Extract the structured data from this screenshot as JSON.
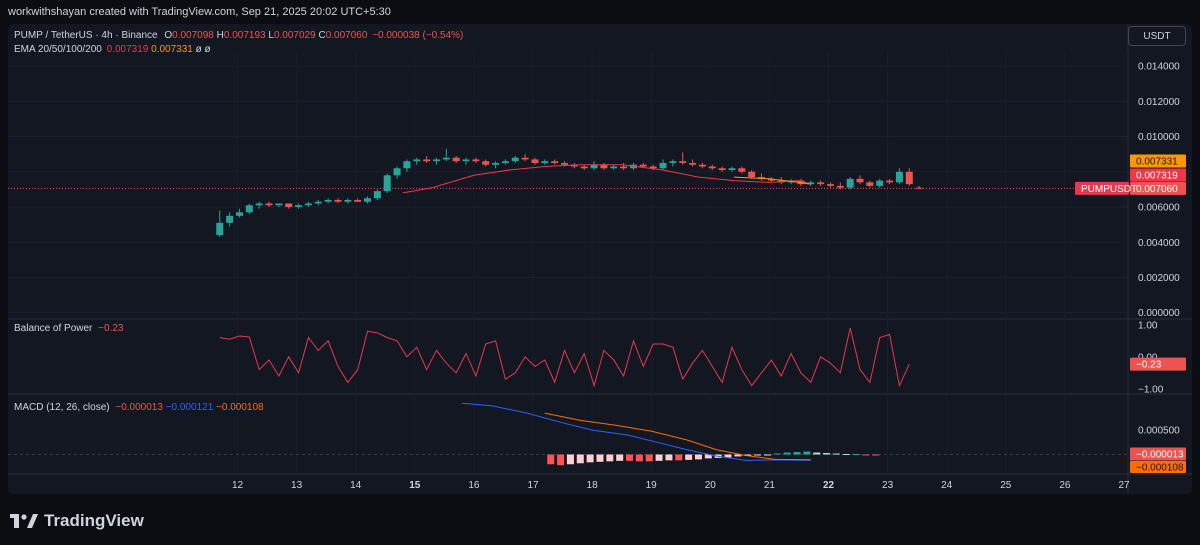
{
  "header": {
    "created_by": "workwithshayan created with TradingView.com, Sep 21, 2025 20:02 UTC+5:30"
  },
  "symbol_legend": {
    "name": "PUMP / TetherUS · 4h · Binance",
    "o_label": "O",
    "o": "0.007098",
    "h_label": "H",
    "h": "0.007193",
    "l_label": "L",
    "l": "0.007029",
    "c_label": "C",
    "c": "0.007060",
    "change": "−0.000038 (−0.54%)"
  },
  "ema_legend": {
    "name": "EMA 20/50/100/200",
    "v20": "0.007319",
    "v50": "0.007331",
    "v100": "ø",
    "v200": "ø"
  },
  "currency_button": "USDT",
  "price_badges": {
    "ema50": "0.007331",
    "ema20": "0.007319",
    "symbol": "PUMPUSDT",
    "last": "0.007060"
  },
  "bop_legend": {
    "name": "Balance of Power",
    "value": "−0.23"
  },
  "macd_legend": {
    "name": "MACD (12, 26, close)",
    "hist": "−0.000013",
    "macd": "−0.000121",
    "signal": "−0.000108"
  },
  "macd_badges": {
    "hist": "−0.000013",
    "signal": "−0.000108"
  },
  "brand": "TradingView",
  "colors": {
    "up": "#26a69a",
    "down": "#ef5350",
    "ema20": "#f23645",
    "ema50": "#ff9800",
    "bop": "#e53950",
    "macd": "#2962ff",
    "signal": "#ff6d00",
    "bg": "#131722",
    "text": "#d1d4dc"
  },
  "chart_data": [
    {
      "type": "candlestick",
      "title": "PUMP / TetherUS · 4h · Binance",
      "x_ticks": [
        "12",
        "13",
        "14",
        "15",
        "16",
        "17",
        "18",
        "19",
        "20",
        "21",
        "22",
        "23",
        "24",
        "25",
        "26",
        "27"
      ],
      "y_ticks": [
        "0.014000",
        "0.012000",
        "0.010000",
        "0.008000",
        "0.006000",
        "0.004000",
        "0.002000",
        "0.000000"
      ],
      "ylim": [
        -0.0003,
        0.0148
      ],
      "x_start_day": 11.7,
      "bars_per_day": 6,
      "candles": [
        {
          "o": 0.0044,
          "h": 0.0058,
          "l": 0.0043,
          "c": 0.0051
        },
        {
          "o": 0.0051,
          "h": 0.0057,
          "l": 0.0049,
          "c": 0.0055
        },
        {
          "o": 0.0055,
          "h": 0.0059,
          "l": 0.0054,
          "c": 0.0057
        },
        {
          "o": 0.0057,
          "h": 0.0062,
          "l": 0.0056,
          "c": 0.0061
        },
        {
          "o": 0.0061,
          "h": 0.0063,
          "l": 0.0059,
          "c": 0.0062
        },
        {
          "o": 0.0062,
          "h": 0.0063,
          "l": 0.006,
          "c": 0.0061
        },
        {
          "o": 0.0061,
          "h": 0.0062,
          "l": 0.006,
          "c": 0.0062
        },
        {
          "o": 0.0062,
          "h": 0.0062,
          "l": 0.0059,
          "c": 0.006
        },
        {
          "o": 0.006,
          "h": 0.0062,
          "l": 0.0059,
          "c": 0.0061
        },
        {
          "o": 0.0061,
          "h": 0.0063,
          "l": 0.006,
          "c": 0.0062
        },
        {
          "o": 0.0062,
          "h": 0.0064,
          "l": 0.0061,
          "c": 0.0063
        },
        {
          "o": 0.0063,
          "h": 0.0065,
          "l": 0.0062,
          "c": 0.0064
        },
        {
          "o": 0.0064,
          "h": 0.0065,
          "l": 0.0062,
          "c": 0.0063
        },
        {
          "o": 0.0063,
          "h": 0.0065,
          "l": 0.0062,
          "c": 0.0064
        },
        {
          "o": 0.0064,
          "h": 0.0065,
          "l": 0.0063,
          "c": 0.0063
        },
        {
          "o": 0.0063,
          "h": 0.0066,
          "l": 0.0062,
          "c": 0.0065
        },
        {
          "o": 0.0065,
          "h": 0.007,
          "l": 0.0064,
          "c": 0.0069
        },
        {
          "o": 0.0069,
          "h": 0.0079,
          "l": 0.0068,
          "c": 0.0078
        },
        {
          "o": 0.0078,
          "h": 0.0083,
          "l": 0.0076,
          "c": 0.0082
        },
        {
          "o": 0.0082,
          "h": 0.0087,
          "l": 0.008,
          "c": 0.0086
        },
        {
          "o": 0.0086,
          "h": 0.0088,
          "l": 0.0084,
          "c": 0.0087
        },
        {
          "o": 0.0087,
          "h": 0.0089,
          "l": 0.0085,
          "c": 0.0086
        },
        {
          "o": 0.0086,
          "h": 0.0088,
          "l": 0.0084,
          "c": 0.0087
        },
        {
          "o": 0.0087,
          "h": 0.0093,
          "l": 0.0086,
          "c": 0.0088
        },
        {
          "o": 0.0088,
          "h": 0.0089,
          "l": 0.0085,
          "c": 0.0086
        },
        {
          "o": 0.0086,
          "h": 0.0088,
          "l": 0.0084,
          "c": 0.0087
        },
        {
          "o": 0.0087,
          "h": 0.0088,
          "l": 0.0085,
          "c": 0.0086
        },
        {
          "o": 0.0086,
          "h": 0.0087,
          "l": 0.0083,
          "c": 0.0084
        },
        {
          "o": 0.0084,
          "h": 0.0086,
          "l": 0.0082,
          "c": 0.0085
        },
        {
          "o": 0.0085,
          "h": 0.0087,
          "l": 0.0084,
          "c": 0.0086
        },
        {
          "o": 0.0086,
          "h": 0.0089,
          "l": 0.0085,
          "c": 0.0088
        },
        {
          "o": 0.0088,
          "h": 0.009,
          "l": 0.0086,
          "c": 0.0087
        },
        {
          "o": 0.0087,
          "h": 0.0088,
          "l": 0.0084,
          "c": 0.0085
        },
        {
          "o": 0.0085,
          "h": 0.0087,
          "l": 0.0084,
          "c": 0.0086
        },
        {
          "o": 0.0086,
          "h": 0.0087,
          "l": 0.0084,
          "c": 0.0085
        },
        {
          "o": 0.0085,
          "h": 0.0086,
          "l": 0.0083,
          "c": 0.0084
        },
        {
          "o": 0.0084,
          "h": 0.0085,
          "l": 0.0082,
          "c": 0.0083
        },
        {
          "o": 0.0083,
          "h": 0.0084,
          "l": 0.0081,
          "c": 0.0082
        },
        {
          "o": 0.0082,
          "h": 0.0086,
          "l": 0.0081,
          "c": 0.0084
        },
        {
          "o": 0.0084,
          "h": 0.0085,
          "l": 0.0081,
          "c": 0.0082
        },
        {
          "o": 0.0082,
          "h": 0.0084,
          "l": 0.0081,
          "c": 0.0083
        },
        {
          "o": 0.0083,
          "h": 0.0085,
          "l": 0.0081,
          "c": 0.0082
        },
        {
          "o": 0.0082,
          "h": 0.0085,
          "l": 0.0081,
          "c": 0.0084
        },
        {
          "o": 0.0084,
          "h": 0.0085,
          "l": 0.0082,
          "c": 0.0083
        },
        {
          "o": 0.0083,
          "h": 0.0084,
          "l": 0.0081,
          "c": 0.0082
        },
        {
          "o": 0.0082,
          "h": 0.0087,
          "l": 0.0081,
          "c": 0.0085
        },
        {
          "o": 0.0085,
          "h": 0.0087,
          "l": 0.0083,
          "c": 0.0086
        },
        {
          "o": 0.0086,
          "h": 0.0091,
          "l": 0.0084,
          "c": 0.0085
        },
        {
          "o": 0.0085,
          "h": 0.0087,
          "l": 0.0083,
          "c": 0.0084
        },
        {
          "o": 0.0084,
          "h": 0.0085,
          "l": 0.0082,
          "c": 0.0083
        },
        {
          "o": 0.0083,
          "h": 0.0084,
          "l": 0.0081,
          "c": 0.0082
        },
        {
          "o": 0.0082,
          "h": 0.0083,
          "l": 0.008,
          "c": 0.0081
        },
        {
          "o": 0.0081,
          "h": 0.0083,
          "l": 0.008,
          "c": 0.0082
        },
        {
          "o": 0.0082,
          "h": 0.0083,
          "l": 0.0079,
          "c": 0.008
        },
        {
          "o": 0.008,
          "h": 0.0081,
          "l": 0.0076,
          "c": 0.0077
        },
        {
          "o": 0.0077,
          "h": 0.0079,
          "l": 0.0075,
          "c": 0.0076
        },
        {
          "o": 0.0076,
          "h": 0.0077,
          "l": 0.0074,
          "c": 0.0075
        },
        {
          "o": 0.0075,
          "h": 0.0077,
          "l": 0.0073,
          "c": 0.0074
        },
        {
          "o": 0.0074,
          "h": 0.0076,
          "l": 0.0073,
          "c": 0.0075
        },
        {
          "o": 0.0075,
          "h": 0.0076,
          "l": 0.0072,
          "c": 0.0073
        },
        {
          "o": 0.0073,
          "h": 0.0075,
          "l": 0.0072,
          "c": 0.0074
        },
        {
          "o": 0.0074,
          "h": 0.0075,
          "l": 0.0072,
          "c": 0.0073
        },
        {
          "o": 0.0073,
          "h": 0.0074,
          "l": 0.0071,
          "c": 0.0072
        },
        {
          "o": 0.0072,
          "h": 0.0074,
          "l": 0.007,
          "c": 0.0071
        },
        {
          "o": 0.0071,
          "h": 0.0077,
          "l": 0.007,
          "c": 0.0076
        },
        {
          "o": 0.0076,
          "h": 0.0078,
          "l": 0.0073,
          "c": 0.0074
        },
        {
          "o": 0.0074,
          "h": 0.0075,
          "l": 0.0071,
          "c": 0.0072
        },
        {
          "o": 0.0072,
          "h": 0.0076,
          "l": 0.0071,
          "c": 0.0075
        },
        {
          "o": 0.0075,
          "h": 0.0076,
          "l": 0.0073,
          "c": 0.0074
        },
        {
          "o": 0.0074,
          "h": 0.0082,
          "l": 0.0073,
          "c": 0.008
        },
        {
          "o": 0.008,
          "h": 0.0082,
          "l": 0.0072,
          "c": 0.0073
        },
        {
          "o": 0.007098,
          "h": 0.007193,
          "l": 0.007029,
          "c": 0.00706
        }
      ],
      "ema20": [
        [
          14.8,
          0.0068
        ],
        [
          15.3,
          0.0071
        ],
        [
          16.0,
          0.0078
        ],
        [
          16.6,
          0.0081
        ],
        [
          17.2,
          0.0083
        ],
        [
          17.8,
          0.0084
        ],
        [
          18.5,
          0.0084
        ],
        [
          19.2,
          0.0081
        ],
        [
          19.8,
          0.0077
        ],
        [
          20.4,
          0.0075
        ],
        [
          21.0,
          0.0074
        ],
        [
          21.5,
          0.0075
        ],
        [
          21.7,
          0.0073
        ]
      ],
      "ema50": [
        [
          20.4,
          0.0077
        ],
        [
          21.0,
          0.0076
        ],
        [
          21.5,
          0.0074
        ],
        [
          21.7,
          0.0073
        ]
      ],
      "last_price": 0.00706
    },
    {
      "type": "line",
      "title": "Balance of Power",
      "y_ticks": [
        "1.00",
        "0.00",
        "−1.00"
      ],
      "ylim": [
        -1.1,
        1.15
      ],
      "x_start_day": 11.7,
      "bars_per_day": 6,
      "values": [
        0.6,
        0.55,
        0.65,
        0.62,
        -0.4,
        -0.1,
        -0.6,
        0.0,
        -0.5,
        0.6,
        0.2,
        0.5,
        -0.3,
        -0.8,
        -0.4,
        0.8,
        0.75,
        0.6,
        0.5,
        0.0,
        0.3,
        -0.4,
        0.2,
        -0.2,
        -0.5,
        0.1,
        -0.6,
        0.4,
        0.5,
        -0.7,
        -0.5,
        0.0,
        -0.3,
        -0.1,
        -0.8,
        0.2,
        -0.5,
        0.1,
        -0.9,
        0.2,
        -0.1,
        -0.6,
        0.5,
        -0.3,
        0.4,
        0.4,
        0.3,
        -0.7,
        -0.2,
        0.2,
        -0.3,
        -0.8,
        0.3,
        -0.4,
        -0.9,
        -0.5,
        -0.1,
        -0.6,
        0.1,
        -0.5,
        -0.8,
        0.0,
        -0.2,
        -0.5,
        0.9,
        -0.4,
        -0.8,
        0.6,
        0.7,
        -0.9,
        -0.23
      ]
    },
    {
      "type": "bar",
      "title": "MACD (12, 26, close)",
      "y_ticks": [
        "0.000500"
      ],
      "ylim": [
        -0.0004,
        0.0012
      ],
      "macd_line": [
        [
          15.8,
          0.00105
        ],
        [
          16.3,
          0.001
        ],
        [
          16.9,
          0.00085
        ],
        [
          17.5,
          0.00065
        ],
        [
          18.0,
          0.0005
        ],
        [
          18.6,
          0.0004
        ],
        [
          19.1,
          0.00025
        ],
        [
          19.6,
          0.0001
        ],
        [
          20.1,
          -3e-05
        ],
        [
          20.6,
          -0.00012
        ],
        [
          21.1,
          -0.00011
        ],
        [
          21.7,
          -0.000121
        ]
      ],
      "signal_line": [
        [
          17.2,
          0.00085
        ],
        [
          17.8,
          0.0007
        ],
        [
          18.4,
          0.0006
        ],
        [
          19.0,
          0.00048
        ],
        [
          19.6,
          0.0003
        ],
        [
          20.1,
          0.0001
        ],
        [
          20.6,
          -2e-05
        ],
        [
          21.1,
          -0.0001
        ],
        [
          21.7,
          -0.000108
        ]
      ],
      "histogram": [
        -0.0002,
        -0.00022,
        -0.0002,
        -0.00018,
        -0.00016,
        -0.00015,
        -0.00014,
        -0.00013,
        -0.00013,
        -0.00014,
        -0.00014,
        -0.00013,
        -0.00012,
        -0.00012,
        -0.00011,
        -0.0001,
        -8e-05,
        -7e-05,
        -6e-05,
        -4e-05,
        -3e-05,
        -2e-05,
        -1e-05,
        2e-05,
        4e-05,
        5e-05,
        6e-05,
        4e-05,
        3e-05,
        2e-05,
        1e-05,
        1e-05,
        -1e-05,
        -1.3e-05
      ],
      "histogram_start_day": 17.3,
      "last_values": {
        "hist": -1.3e-05,
        "macd": -0.000121,
        "signal": -0.000108
      }
    }
  ]
}
